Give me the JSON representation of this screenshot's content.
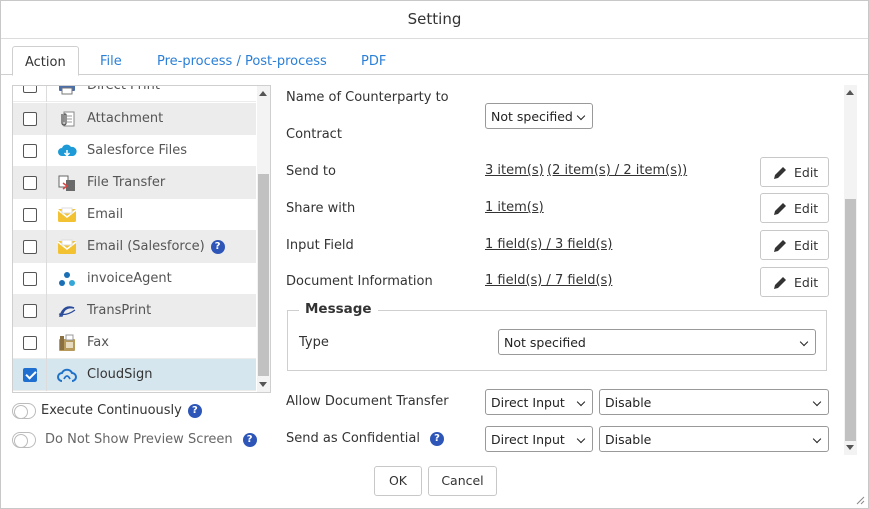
{
  "dialog": {
    "title": "Setting"
  },
  "tabs": [
    {
      "label": "Action",
      "active": true
    },
    {
      "label": "File"
    },
    {
      "label": "Pre-process / Post-process"
    },
    {
      "label": "PDF"
    }
  ],
  "actions": [
    {
      "label": "Direct Print",
      "checked": false,
      "icon": "printer-icon"
    },
    {
      "label": "Attachment",
      "checked": false,
      "icon": "attachment-icon"
    },
    {
      "label": "Salesforce Files",
      "checked": false,
      "icon": "salesforce-cloud-icon"
    },
    {
      "label": "File Transfer",
      "checked": false,
      "icon": "file-transfer-icon"
    },
    {
      "label": "Email",
      "checked": false,
      "icon": "email-icon"
    },
    {
      "label": "Email (Salesforce)",
      "checked": false,
      "icon": "email-salesforce-icon",
      "help": true
    },
    {
      "label": "invoiceAgent",
      "checked": false,
      "icon": "invoiceagent-icon"
    },
    {
      "label": "TransPrint",
      "checked": false,
      "icon": "transprint-icon"
    },
    {
      "label": "Fax",
      "checked": false,
      "icon": "fax-icon"
    },
    {
      "label": "CloudSign",
      "checked": true,
      "icon": "cloudsign-icon",
      "selected": true
    }
  ],
  "options": {
    "execute_continuously": "Execute Continuously",
    "do_not_show_preview": "Do Not Show Preview Screen"
  },
  "settings": {
    "counterparty_label_line1": "Name of Counterparty to",
    "counterparty_label_line2": "Contract",
    "counterparty_value": "Not specified",
    "send_to_label": "Send to",
    "send_to_link1": "3 item(s)",
    "send_to_link2": "(2 item(s) / 2 item(s))",
    "share_with_label": "Share with",
    "share_with_link": "1 item(s)",
    "input_field_label": "Input Field",
    "input_field_link": "1 field(s) / 3 field(s)",
    "doc_info_label": "Document Information",
    "doc_info_link": "1 field(s) / 7 field(s)",
    "edit_label": "Edit",
    "message_legend": "Message",
    "message_type_label": "Type",
    "message_type_value": "Not specified",
    "allow_transfer_label": "Allow Document Transfer",
    "allow_transfer_mode": "Direct Input",
    "allow_transfer_value": "Disable",
    "confidential_label": "Send as Confidential",
    "confidential_mode": "Direct Input",
    "confidential_value": "Disable"
  },
  "footer": {
    "ok": "OK",
    "cancel": "Cancel"
  },
  "colors": {
    "link_blue": "#2a7fd6",
    "check_blue": "#1f6fd1",
    "selected_row": "#d6e6ef"
  }
}
